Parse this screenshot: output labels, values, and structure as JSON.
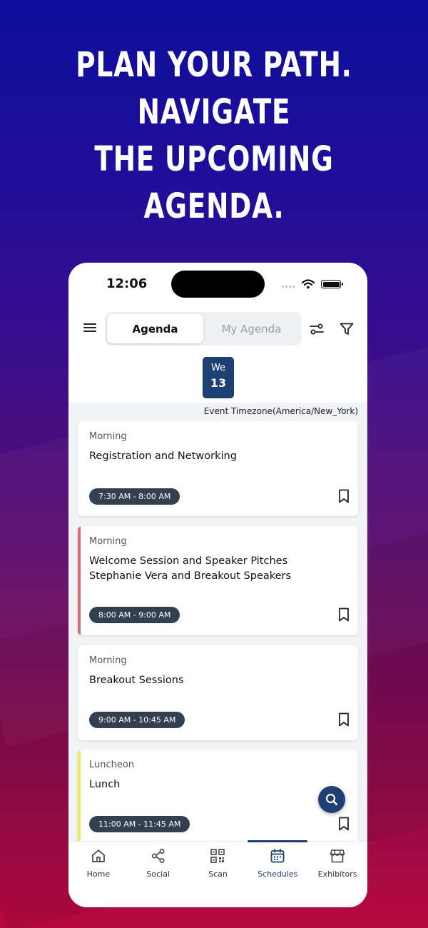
{
  "headline": {
    "line1": "PLAN YOUR PATH. NAVIGATE",
    "line2": "THE UPCOMING AGENDA."
  },
  "status_bar": {
    "time": "12:06"
  },
  "header": {
    "tabs": [
      {
        "label": "Agenda",
        "active": true
      },
      {
        "label": "My Agenda",
        "active": false
      }
    ],
    "icons": [
      "menu-icon",
      "sliders-icon",
      "filter-icon"
    ]
  },
  "date_selector": {
    "day_of_week": "We",
    "day_number": "13"
  },
  "timezone_note": "Event Timezone(America/New_York)",
  "sessions": [
    {
      "category": "Morning",
      "title": "Registration and Networking",
      "time": "7:30 AM - 8:00 AM",
      "accent_color": ""
    },
    {
      "category": "Morning",
      "title": "Welcome Session and Speaker Pitches Stephanie Vera and Breakout Speakers",
      "time": "8:00 AM - 9:00 AM",
      "accent_color": "#d26b7c"
    },
    {
      "category": "Morning",
      "title": "Breakout Sessions",
      "time": "9:00 AM - 10:45 AM",
      "accent_color": ""
    },
    {
      "category": "Luncheon",
      "title": "Lunch",
      "time": "11:00 AM - 11:45 AM",
      "accent_color": "#f2ea5c"
    }
  ],
  "bottom_nav": [
    {
      "label": "Home",
      "icon": "home-icon",
      "active": false
    },
    {
      "label": "Social",
      "icon": "share-icon",
      "active": false
    },
    {
      "label": "Scan",
      "icon": "qr-code-icon",
      "active": false
    },
    {
      "label": "Schedules",
      "icon": "calendar-icon",
      "active": true
    },
    {
      "label": "Exhibitors",
      "icon": "store-icon",
      "active": false
    }
  ],
  "colors": {
    "primary": "#1e3f72",
    "pill_background": "#34404f",
    "background_top": "#0d0f9c",
    "background_bottom": "#b8093f"
  }
}
